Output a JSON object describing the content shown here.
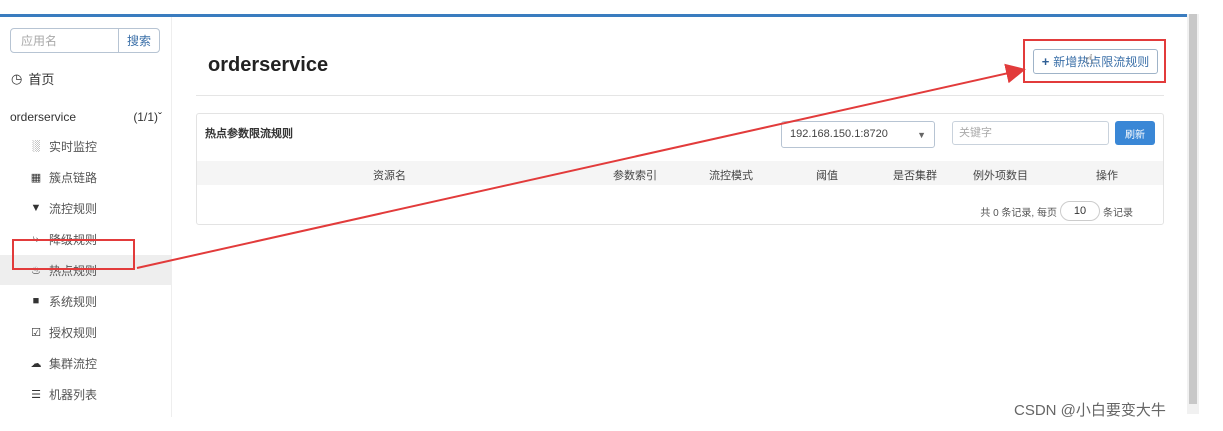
{
  "sidebar": {
    "search_placeholder": "应用名",
    "search_button": "搜索",
    "home": "首页",
    "app_name": "orderservice",
    "app_count": "(1/1)",
    "items": [
      {
        "label": "实时监控",
        "icon": "chart-icon"
      },
      {
        "label": "簇点链路",
        "icon": "list-icon"
      },
      {
        "label": "流控规则",
        "icon": "filter-icon"
      },
      {
        "label": "降级规则",
        "icon": "bolt-icon"
      },
      {
        "label": "热点规则",
        "icon": "fire-icon"
      },
      {
        "label": "系统规则",
        "icon": "lock-icon"
      },
      {
        "label": "授权规则",
        "icon": "check-icon"
      },
      {
        "label": "集群流控",
        "icon": "cloud-icon"
      },
      {
        "label": "机器列表",
        "icon": "table-icon"
      }
    ]
  },
  "main": {
    "title": "orderservice",
    "add_button": "新增热点限流规则",
    "panel_title": "热点参数限流规则",
    "machine": "192.168.150.1:8720",
    "keyword_placeholder": "关键字",
    "refresh": "刷新",
    "columns": [
      "资源名",
      "参数索引",
      "流控模式",
      "阈值",
      "是否集群",
      "例外项数目",
      "操作"
    ],
    "pager_prefix": "共 0 条记录, 每页",
    "page_size": "10",
    "pager_suffix": "条记录"
  },
  "watermark": "CSDN @小白要变大牛",
  "colors": {
    "accent": "#3a87d6",
    "highlight": "#e23b3b"
  }
}
